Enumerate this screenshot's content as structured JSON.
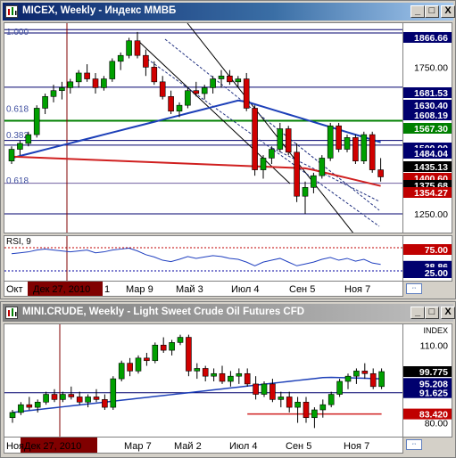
{
  "window1": {
    "title": "MICEX, Weekly - Индекс ММВБ",
    "buttons": {
      "minimize": "_",
      "maximize": "□",
      "close": "X"
    }
  },
  "window2": {
    "title": "MINI.CRUDE, Weekly - Light Sweet Crude Oil Futures CFD",
    "buttons": {
      "minimize": "_",
      "maximize": "□",
      "close": "X"
    }
  },
  "chart_data": [
    {
      "type": "candlestick",
      "title": "MICEX, Weekly - Индекс ММВБ",
      "x_ticks": [
        "Окт",
        "Дек 27, 2010",
        "1",
        "Мар 9",
        "Май 3",
        "Июл 4",
        "Сен 5",
        "Ноя 7"
      ],
      "y_ticks": [
        1750.0,
        1250.0
      ],
      "price_labels": [
        {
          "value": "1866.66",
          "color": "#00006e"
        },
        {
          "value": "1681.53",
          "color": "#00006e"
        },
        {
          "value": "1630.40",
          "color": "#00006e"
        },
        {
          "value": "1608.19",
          "color": "#00006e"
        },
        {
          "value": "1567.30",
          "color": "#008000"
        },
        {
          "value": "1500.00",
          "color": "#00006e"
        },
        {
          "value": "1484.04",
          "color": "#00006e"
        },
        {
          "value": "1435.13",
          "color": "#000000"
        },
        {
          "value": "1400.60",
          "color": "#c00000"
        },
        {
          "value": "1375.68",
          "color": "#000000"
        },
        {
          "value": "1354.27",
          "color": "#c00000"
        }
      ],
      "fib_labels": [
        "1.000",
        "0.618",
        "0.382",
        "0.618"
      ],
      "candles": [
        {
          "o": 1430,
          "h": 1480,
          "l": 1420,
          "c": 1470
        },
        {
          "o": 1470,
          "h": 1500,
          "l": 1450,
          "c": 1490
        },
        {
          "o": 1490,
          "h": 1530,
          "l": 1480,
          "c": 1520
        },
        {
          "o": 1520,
          "h": 1620,
          "l": 1510,
          "c": 1610
        },
        {
          "o": 1610,
          "h": 1660,
          "l": 1590,
          "c": 1650
        },
        {
          "o": 1650,
          "h": 1690,
          "l": 1630,
          "c": 1670
        },
        {
          "o": 1670,
          "h": 1700,
          "l": 1640,
          "c": 1680
        },
        {
          "o": 1680,
          "h": 1710,
          "l": 1660,
          "c": 1700
        },
        {
          "o": 1700,
          "h": 1740,
          "l": 1680,
          "c": 1730
        },
        {
          "o": 1730,
          "h": 1760,
          "l": 1700,
          "c": 1710
        },
        {
          "o": 1710,
          "h": 1730,
          "l": 1660,
          "c": 1680
        },
        {
          "o": 1680,
          "h": 1720,
          "l": 1670,
          "c": 1710
        },
        {
          "o": 1710,
          "h": 1780,
          "l": 1700,
          "c": 1770
        },
        {
          "o": 1770,
          "h": 1800,
          "l": 1740,
          "c": 1790
        },
        {
          "o": 1790,
          "h": 1850,
          "l": 1780,
          "c": 1840
        },
        {
          "o": 1840,
          "h": 1870,
          "l": 1780,
          "c": 1790
        },
        {
          "o": 1790,
          "h": 1810,
          "l": 1720,
          "c": 1750
        },
        {
          "o": 1750,
          "h": 1770,
          "l": 1690,
          "c": 1700
        },
        {
          "o": 1700,
          "h": 1720,
          "l": 1640,
          "c": 1650
        },
        {
          "o": 1650,
          "h": 1670,
          "l": 1590,
          "c": 1600
        },
        {
          "o": 1600,
          "h": 1630,
          "l": 1580,
          "c": 1620
        },
        {
          "o": 1620,
          "h": 1680,
          "l": 1610,
          "c": 1670
        },
        {
          "o": 1670,
          "h": 1700,
          "l": 1650,
          "c": 1660
        },
        {
          "o": 1660,
          "h": 1690,
          "l": 1640,
          "c": 1680
        },
        {
          "o": 1680,
          "h": 1720,
          "l": 1660,
          "c": 1710
        },
        {
          "o": 1710,
          "h": 1740,
          "l": 1680,
          "c": 1720
        },
        {
          "o": 1720,
          "h": 1740,
          "l": 1690,
          "c": 1700
        },
        {
          "o": 1700,
          "h": 1720,
          "l": 1680,
          "c": 1710
        },
        {
          "o": 1710,
          "h": 1730,
          "l": 1600,
          "c": 1610
        },
        {
          "o": 1610,
          "h": 1620,
          "l": 1380,
          "c": 1400
        },
        {
          "o": 1400,
          "h": 1450,
          "l": 1370,
          "c": 1440
        },
        {
          "o": 1440,
          "h": 1480,
          "l": 1420,
          "c": 1470
        },
        {
          "o": 1470,
          "h": 1560,
          "l": 1460,
          "c": 1540
        },
        {
          "o": 1540,
          "h": 1550,
          "l": 1450,
          "c": 1460
        },
        {
          "o": 1460,
          "h": 1490,
          "l": 1290,
          "c": 1310
        },
        {
          "o": 1310,
          "h": 1360,
          "l": 1250,
          "c": 1340
        },
        {
          "o": 1340,
          "h": 1390,
          "l": 1320,
          "c": 1380
        },
        {
          "o": 1380,
          "h": 1450,
          "l": 1370,
          "c": 1440
        },
        {
          "o": 1440,
          "h": 1560,
          "l": 1430,
          "c": 1550
        },
        {
          "o": 1550,
          "h": 1560,
          "l": 1460,
          "c": 1470
        },
        {
          "o": 1470,
          "h": 1520,
          "l": 1460,
          "c": 1510
        },
        {
          "o": 1510,
          "h": 1520,
          "l": 1420,
          "c": 1430
        },
        {
          "o": 1430,
          "h": 1530,
          "l": 1420,
          "c": 1520
        },
        {
          "o": 1520,
          "h": 1530,
          "l": 1390,
          "c": 1400
        },
        {
          "o": 1400,
          "h": 1440,
          "l": 1360,
          "c": 1376
        }
      ],
      "rsi": {
        "label": "RSI, 9",
        "levels": [
          "75.00",
          "38.86",
          "25.00"
        ],
        "values": [
          62,
          64,
          66,
          70,
          72,
          70,
          68,
          66,
          68,
          70,
          64,
          66,
          70,
          72,
          74,
          68,
          60,
          55,
          48,
          45,
          50,
          56,
          52,
          55,
          58,
          56,
          52,
          50,
          44,
          36,
          44,
          48,
          52,
          44,
          36,
          40,
          44,
          50,
          54,
          48,
          52,
          46,
          50,
          42,
          39
        ]
      }
    },
    {
      "type": "candlestick",
      "title": "MINI.CRUDE, Weekly - Light Sweet Crude Oil Futures CFD",
      "x_ticks": [
        "Ноя",
        "Дек 27, 2010",
        "Мар 7",
        "Май 2",
        "Июл 4",
        "Сен 5",
        "Ноя 7"
      ],
      "y_ticks": [
        110.0,
        80.0
      ],
      "index_label": "INDEX",
      "price_labels": [
        {
          "value": "99.775",
          "color": "#000000"
        },
        {
          "value": "95.208",
          "color": "#00006e"
        },
        {
          "value": "91.625",
          "color": "#00006e"
        },
        {
          "value": "83.420",
          "color": "#c00000"
        }
      ],
      "candles": [
        {
          "o": 82,
          "h": 85,
          "l": 80,
          "c": 84
        },
        {
          "o": 84,
          "h": 88,
          "l": 83,
          "c": 87
        },
        {
          "o": 87,
          "h": 90,
          "l": 85,
          "c": 86
        },
        {
          "o": 86,
          "h": 89,
          "l": 84,
          "c": 88
        },
        {
          "o": 88,
          "h": 92,
          "l": 87,
          "c": 91
        },
        {
          "o": 91,
          "h": 93,
          "l": 88,
          "c": 89
        },
        {
          "o": 89,
          "h": 92,
          "l": 88,
          "c": 91
        },
        {
          "o": 91,
          "h": 94,
          "l": 89,
          "c": 90
        },
        {
          "o": 90,
          "h": 92,
          "l": 87,
          "c": 88
        },
        {
          "o": 88,
          "h": 91,
          "l": 86,
          "c": 90
        },
        {
          "o": 90,
          "h": 93,
          "l": 88,
          "c": 89
        },
        {
          "o": 89,
          "h": 91,
          "l": 85,
          "c": 86
        },
        {
          "o": 86,
          "h": 98,
          "l": 85,
          "c": 97
        },
        {
          "o": 97,
          "h": 104,
          "l": 96,
          "c": 103
        },
        {
          "o": 103,
          "h": 105,
          "l": 98,
          "c": 100
        },
        {
          "o": 100,
          "h": 106,
          "l": 99,
          "c": 105
        },
        {
          "o": 105,
          "h": 107,
          "l": 102,
          "c": 104
        },
        {
          "o": 104,
          "h": 111,
          "l": 103,
          "c": 110
        },
        {
          "o": 110,
          "h": 113,
          "l": 107,
          "c": 108
        },
        {
          "o": 108,
          "h": 112,
          "l": 106,
          "c": 111
        },
        {
          "o": 111,
          "h": 114,
          "l": 110,
          "c": 113
        },
        {
          "o": 113,
          "h": 114,
          "l": 98,
          "c": 100
        },
        {
          "o": 100,
          "h": 103,
          "l": 97,
          "c": 101
        },
        {
          "o": 101,
          "h": 102,
          "l": 96,
          "c": 98
        },
        {
          "o": 98,
          "h": 101,
          "l": 96,
          "c": 99
        },
        {
          "o": 99,
          "h": 102,
          "l": 95,
          "c": 96
        },
        {
          "o": 96,
          "h": 100,
          "l": 94,
          "c": 98
        },
        {
          "o": 98,
          "h": 101,
          "l": 95,
          "c": 99
        },
        {
          "o": 99,
          "h": 101,
          "l": 94,
          "c": 95
        },
        {
          "o": 95,
          "h": 98,
          "l": 89,
          "c": 91
        },
        {
          "o": 91,
          "h": 96,
          "l": 90,
          "c": 95
        },
        {
          "o": 95,
          "h": 97,
          "l": 88,
          "c": 89
        },
        {
          "o": 89,
          "h": 92,
          "l": 86,
          "c": 90
        },
        {
          "o": 90,
          "h": 92,
          "l": 84,
          "c": 86
        },
        {
          "o": 86,
          "h": 90,
          "l": 80,
          "c": 88
        },
        {
          "o": 88,
          "h": 90,
          "l": 80,
          "c": 82
        },
        {
          "o": 82,
          "h": 86,
          "l": 78,
          "c": 85
        },
        {
          "o": 85,
          "h": 89,
          "l": 82,
          "c": 87
        },
        {
          "o": 87,
          "h": 92,
          "l": 86,
          "c": 91
        },
        {
          "o": 91,
          "h": 97,
          "l": 90,
          "c": 96
        },
        {
          "o": 96,
          "h": 99,
          "l": 93,
          "c": 98
        },
        {
          "o": 98,
          "h": 101,
          "l": 95,
          "c": 100
        },
        {
          "o": 100,
          "h": 103,
          "l": 97,
          "c": 99
        },
        {
          "o": 99,
          "h": 101,
          "l": 93,
          "c": 94
        },
        {
          "o": 94,
          "h": 101,
          "l": 93,
          "c": 99.775
        }
      ]
    }
  ]
}
